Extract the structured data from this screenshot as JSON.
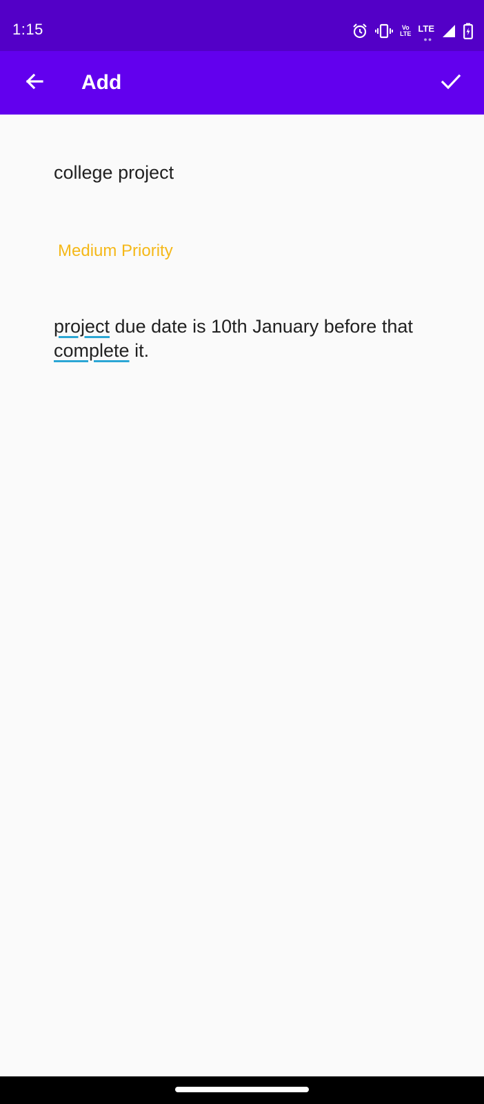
{
  "status_bar": {
    "time": "1:15",
    "volte_top": "Vo",
    "volte_bottom": "LTE",
    "network": "LTE",
    "icons": [
      "alarm-icon",
      "vibrate-icon",
      "volte-icon",
      "signal-icon",
      "battery-charging-icon"
    ]
  },
  "app_bar": {
    "title": "Add",
    "back_icon": "arrow-back-icon",
    "save_icon": "check-icon",
    "background": "#6200EE",
    "status_background": "#5300C7"
  },
  "form": {
    "title_value": "college project",
    "priority_value": "Medium Priority",
    "priority_color": "#F5B818",
    "description_parts": [
      {
        "text": "project",
        "misspelled": true
      },
      {
        "text": " due date is 10th January before that ",
        "misspelled": false
      },
      {
        "text": "complete",
        "misspelled": true
      },
      {
        "text": " it.",
        "misspelled": false
      }
    ]
  },
  "navigation": {
    "home_indicator": "home-handle"
  }
}
